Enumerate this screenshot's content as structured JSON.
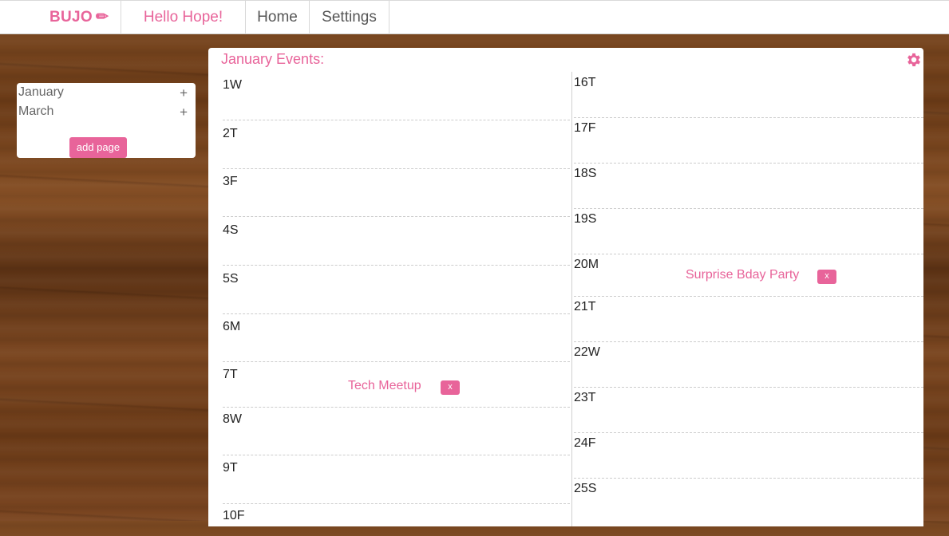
{
  "nav": {
    "brand": "BUJO",
    "brand_icon": "✏",
    "greeting": "Hello Hope!",
    "home": "Home",
    "settings": "Settings"
  },
  "sidebar": {
    "months": [
      {
        "label": "January",
        "add": "+"
      },
      {
        "label": "March",
        "add": "+"
      }
    ],
    "add_page": "add page"
  },
  "panel": {
    "title": "January Events:",
    "settings_icon": "gear-icon"
  },
  "days_left": [
    {
      "label": "1W"
    },
    {
      "label": "2T"
    },
    {
      "label": "3F"
    },
    {
      "label": "4S"
    },
    {
      "label": "5S"
    },
    {
      "label": "6M"
    },
    {
      "label": "7T",
      "event": "Tech Meetup",
      "delete": "x"
    },
    {
      "label": "8W"
    },
    {
      "label": "9T"
    },
    {
      "label": "10F"
    }
  ],
  "days_right": [
    {
      "label": "16T"
    },
    {
      "label": "17F"
    },
    {
      "label": "18S"
    },
    {
      "label": "19S"
    },
    {
      "label": "20M",
      "event": "Surprise Bday Party",
      "delete": "x"
    },
    {
      "label": "21T"
    },
    {
      "label": "22W"
    },
    {
      "label": "23T"
    },
    {
      "label": "24F"
    },
    {
      "label": "25S"
    }
  ],
  "colors": {
    "accent": "#e8649a",
    "nav_text": "#555555",
    "wood": "#6b3b17"
  }
}
